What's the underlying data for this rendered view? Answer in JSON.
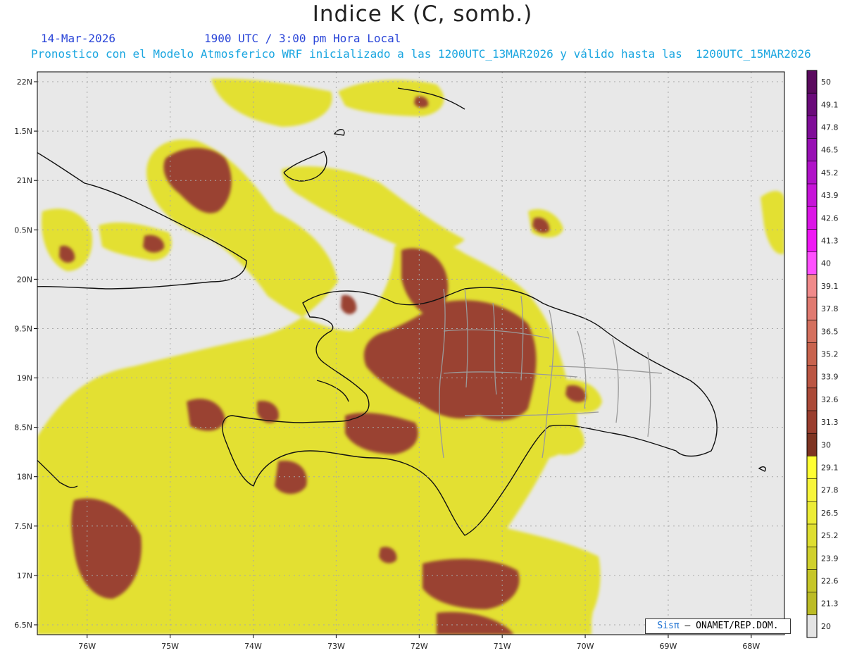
{
  "title": "Indice K (C, somb.)",
  "date_label": "14-Mar-2026",
  "time_label": "1900 UTC / 3:00 pm Hora Local",
  "model_label": "Pronostico con el Modelo Atmosferico WRF inicializado a las 1200UTC_13MAR2026 y válido hasta las  1200UTC_15MAR2026",
  "credit": {
    "brand": "Sisπ",
    "text": "– ONAMET/REP.DOM."
  },
  "map": {
    "lon_range": [
      -76.6,
      -67.6
    ],
    "lat_range": [
      16.4,
      22.1
    ],
    "lon_ticks": [
      -76,
      -75,
      -74,
      -73,
      -72,
      -71,
      -70,
      -69,
      -68
    ],
    "lon_tick_labels": [
      "76W",
      "75W",
      "74W",
      "73W",
      "72W",
      "71W",
      "70W",
      "69W",
      "68W"
    ],
    "lat_ticks": [
      16.5,
      17,
      17.5,
      18,
      18.5,
      19,
      19.5,
      20,
      20.5,
      21,
      21.5,
      22
    ],
    "lat_tick_labels": [
      "6.5N",
      "17N",
      "7.5N",
      "18N",
      "8.5N",
      "19N",
      "9.5N",
      "20N",
      "0.5N",
      "21N",
      "1.5N",
      "22N"
    ],
    "grid": true,
    "background_color": "#e8e8e8",
    "coast_color": "#111111",
    "border_color": "#9a9a9a"
  },
  "colorbar": {
    "labels": [
      "50",
      "49.1",
      "47.8",
      "46.5",
      "45.2",
      "43.9",
      "42.6",
      "41.3",
      "40",
      "39.1",
      "37.8",
      "36.5",
      "35.2",
      "33.9",
      "32.6",
      "31.3",
      "30",
      "29.1",
      "27.8",
      "26.5",
      "25.2",
      "23.9",
      "22.6",
      "21.3",
      "20"
    ],
    "colors": [
      "#5a0a5e",
      "#6a0b7a",
      "#7f0d98",
      "#9810b4",
      "#b012c8",
      "#c614d8",
      "#db16e6",
      "#ef18f4",
      "#ff50ff",
      "#f08a8a",
      "#e07a70",
      "#d4705e",
      "#c8634e",
      "#bb5643",
      "#ab4a38",
      "#9a3e2e",
      "#7e3422",
      "#ffff33",
      "#f7f53a",
      "#ecec36",
      "#dede30",
      "#d0d02c",
      "#c6c628",
      "#bcbc26",
      "#e4e4e4"
    ]
  }
}
